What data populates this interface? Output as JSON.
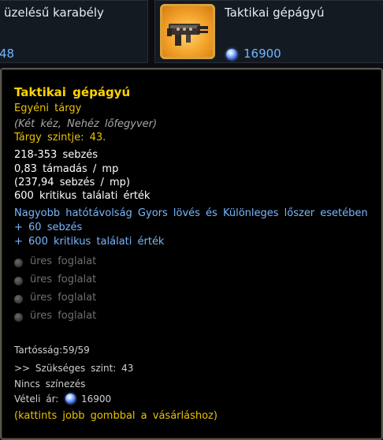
{
  "shop": {
    "left_item": {
      "name": "üzelésű karabély",
      "price": "48"
    },
    "right_item": {
      "name": "Taktikai gépágyú",
      "price": "16900",
      "icon": "machine-gun-icon"
    }
  },
  "tooltip": {
    "title": "Taktikai gépágyú",
    "rarity": "Egyéni tárgy",
    "type": "(Két kéz, Nehéz lőfegyver)",
    "item_level": "Tárgy szintje: 43.",
    "stats": [
      "218-353 sebzés",
      "0,83 támadás / mp",
      "(237,94 sebzés / mp)",
      "600 kritikus találati érték"
    ],
    "bonuses": [
      "Nagyobb hatótávolság Gyors lövés és Különleges lőszer esetében",
      "+ 60 sebzés",
      "+ 600 kritikus találati érték"
    ],
    "sockets": [
      "üres foglalat",
      "üres foglalat",
      "üres foglalat",
      "üres foglalat"
    ],
    "durability": "Tartósság:59/59",
    "required_level": ">> Szükséges szint: 43",
    "dye": "Nincs színezés",
    "buy_price_label": "Vételi ár:",
    "buy_price": "16900",
    "hint": "(kattints jobb gombbal a vásárláshoz)"
  },
  "colors": {
    "title": "#ffd400",
    "rarity": "#e9c200",
    "bonus": "#78b6ff",
    "price": "#6fb7ff"
  }
}
